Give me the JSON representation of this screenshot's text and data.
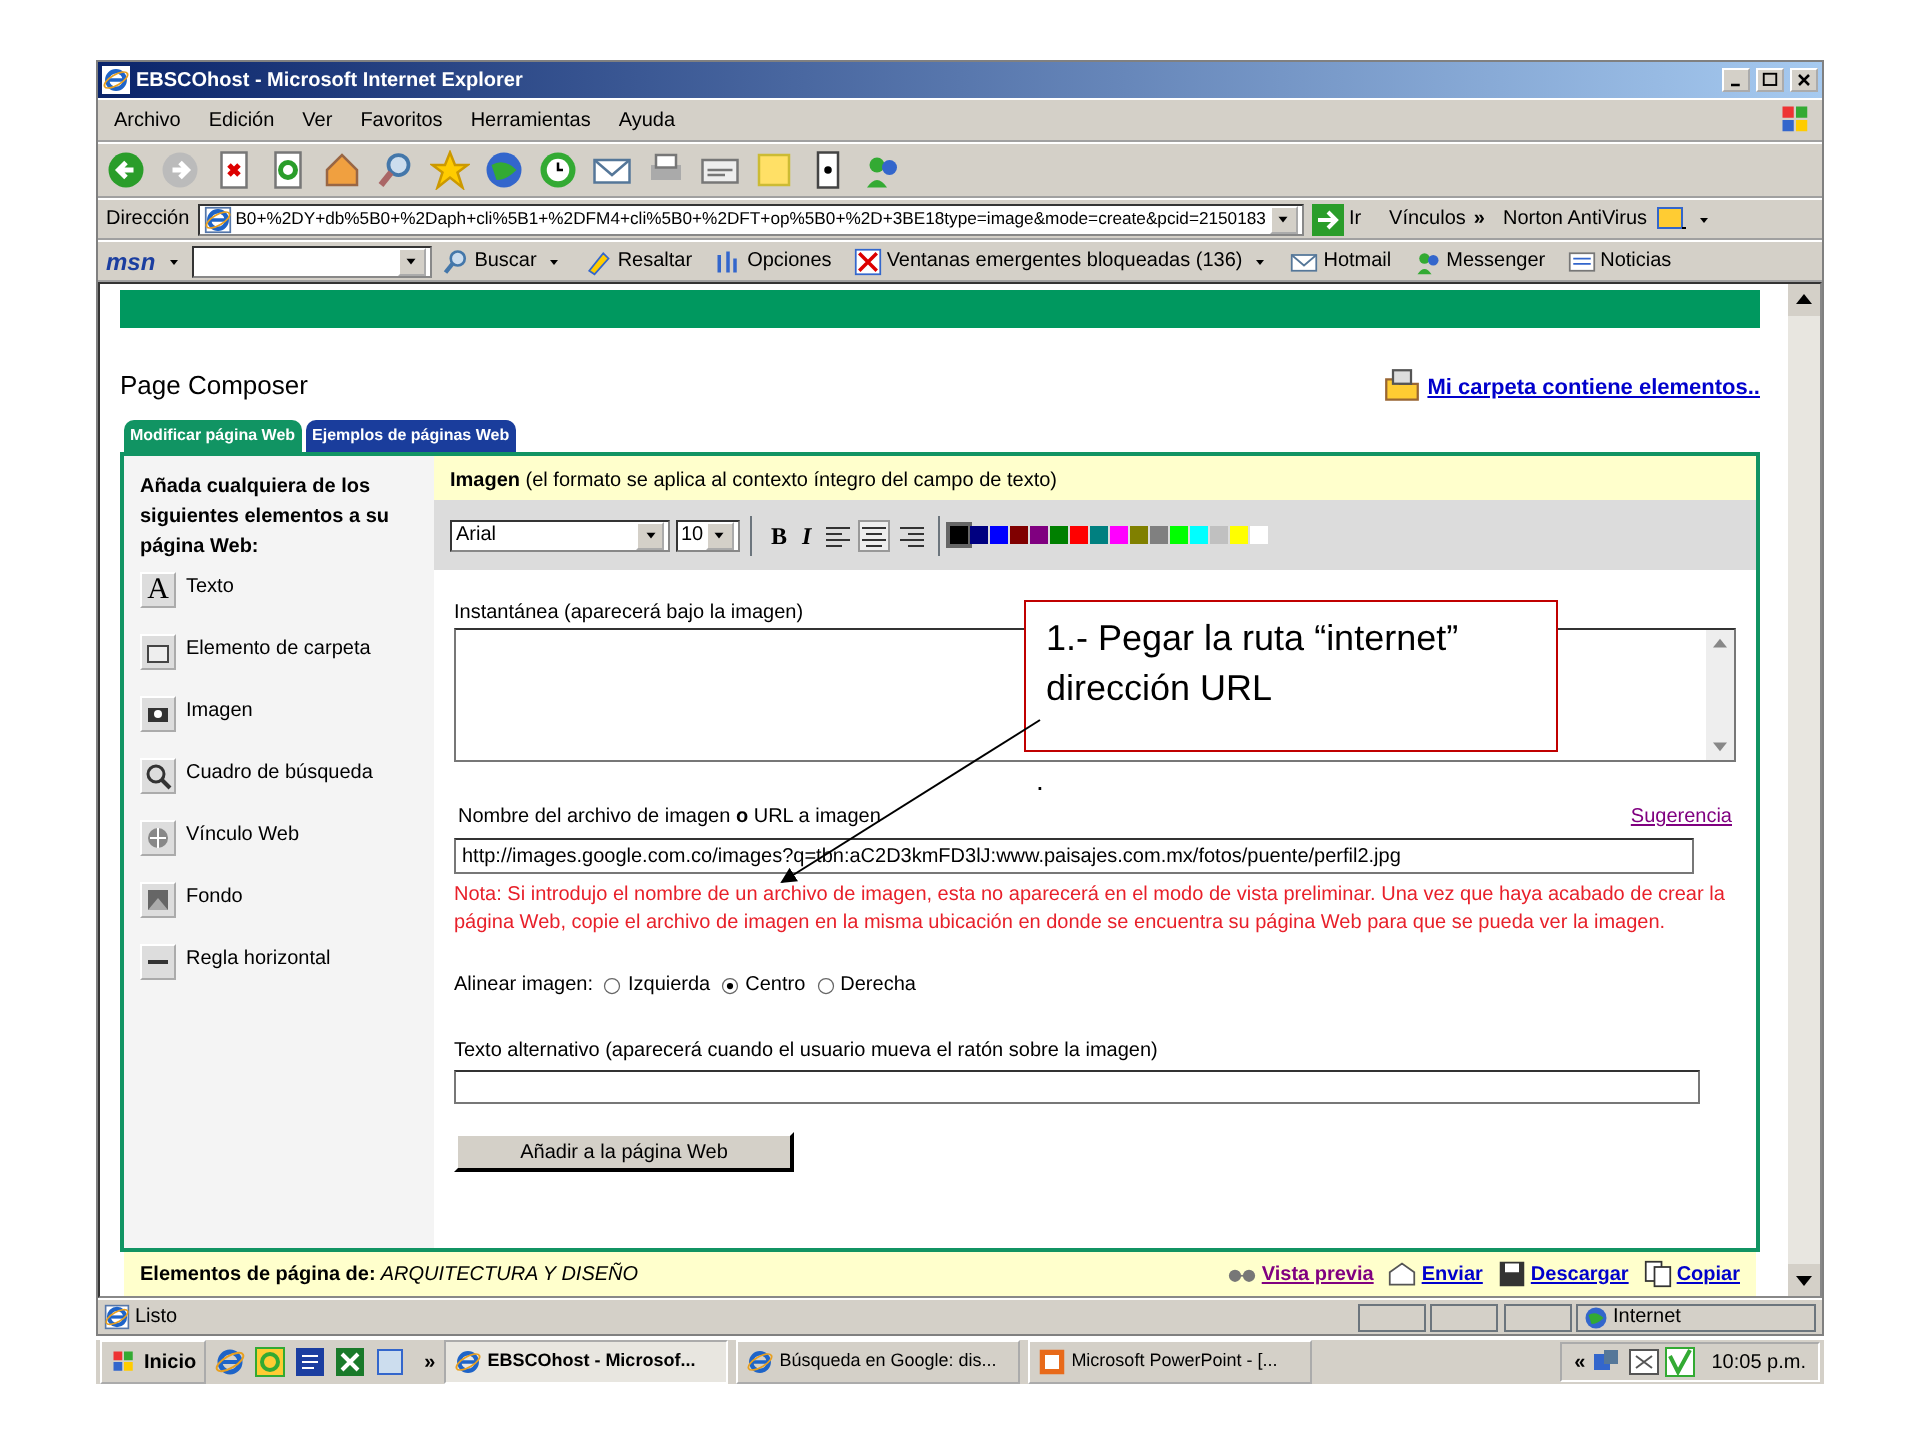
{
  "window": {
    "title": "EBSCOhost - Microsoft Internet Explorer"
  },
  "menu_bar": [
    "Archivo",
    "Edición",
    "Ver",
    "Favoritos",
    "Herramientas",
    "Ayuda"
  ],
  "address_bar": {
    "label": "Dirección",
    "value": "B0+%2DY+db%5B0+%2Daph+cli%5B1+%2DFM4+cli%5B0+%2DFT+op%5B0+%2D+3BE18type=image&mode=create&pcid=2150183",
    "go": "Ir",
    "links": "Vínculos",
    "chevron": "»",
    "extra": "Norton AntiVirus"
  },
  "msn_bar": {
    "logo": "msn",
    "items": [
      "Buscar",
      "Resaltar",
      "Opciones",
      "Ventanas emergentes bloqueadas (136)",
      "Hotmail",
      "Messenger",
      "Noticias"
    ]
  },
  "page": {
    "title": "Page Composer",
    "folder_link": "Mi carpeta contiene elementos..",
    "tabs": [
      {
        "label": "Modificar página Web",
        "selected": true
      },
      {
        "label": "Ejemplos de páginas Web",
        "selected": false
      }
    ],
    "sidebar": {
      "text_icon_letter": "A",
      "heading": "Añada cualquiera de los siguientes elementos a su página Web:",
      "items": [
        "Texto",
        "Elemento de carpeta",
        "Imagen",
        "Cuadro de búsqueda",
        "Vínculo Web",
        "Fondo",
        "Regla horizontal"
      ]
    },
    "editor": {
      "header": "**Imagen** (el formato se aplica al contexto íntegro del campo de texto)",
      "font": "Arial",
      "size": "10",
      "bold_label": "B",
      "italic_label": "I",
      "colors": [
        {
          "color": "#000000",
          "selected": true
        },
        {
          "color": "#000080",
          "selected": false
        },
        {
          "color": "#0000ff",
          "selected": false
        },
        {
          "color": "#800000",
          "selected": false
        },
        {
          "color": "#800080",
          "selected": false
        },
        {
          "color": "#008000",
          "selected": false
        },
        {
          "color": "#ff0000",
          "selected": false
        },
        {
          "color": "#008080",
          "selected": false
        },
        {
          "color": "#ff00ff",
          "selected": false
        },
        {
          "color": "#808000",
          "selected": false
        },
        {
          "color": "#808080",
          "selected": false
        },
        {
          "color": "#00ff00",
          "selected": false
        },
        {
          "color": "#00ffff",
          "selected": false
        },
        {
          "color": "#c0c0c0",
          "selected": false
        },
        {
          "color": "#ffff00",
          "selected": false
        },
        {
          "color": "#ffffff",
          "selected": false
        }
      ],
      "caption_label": "Instantánea (aparecerá bajo la imagen)",
      "url_label": "Nombre del archivo de imagen **o** URL a imagen",
      "hint_link": "Sugerencia",
      "url_value": "http://images.google.com.co/images?q=tbn:aC2D3kmFD3lJ:www.paisajes.com.mx/fotos/puente/perfil2.jpg",
      "note": "Nota: Si introdujo el nombre de un archivo de imagen, esta no aparecerá en el modo de vista preliminar. Una vez que haya acabado de crear la página Web, copie el archivo de imagen en la misma ubicación en donde se encuentra su página Web para que se pueda ver la imagen.",
      "align_label": "Alinear imagen:",
      "align_options": [
        {
          "label": "Izquierda",
          "selected": false
        },
        {
          "label": "Centro",
          "selected": true
        },
        {
          "label": "Derecha",
          "selected": false
        }
      ],
      "alt_label": "Texto alternativo (aparecerá cuando el usuario mueva el ratón sobre la imagen)",
      "add_button": "Añadir a la página Web"
    },
    "footer": {
      "label": "Elementos de página de:",
      "folder": "ARQUITECTURA Y DISEÑO",
      "links": [
        "Vista previa",
        "Enviar",
        "Descargar",
        "Copiar"
      ]
    }
  },
  "callout": {
    "lines": [
      "1.- Pegar la ruta “internet”",
      "dirección URL"
    ],
    "dot": "."
  },
  "status_bar": {
    "text": "Listo",
    "zone": "Internet"
  },
  "taskbar": {
    "start": "Inicio",
    "chevron": "»",
    "tasks": [
      {
        "label": "EBSCOhost - Microsof...",
        "selected": true
      },
      {
        "label": "Búsqueda en Google: dis...",
        "selected": false
      },
      {
        "label": "Microsoft PowerPoint - [...",
        "selected": false
      }
    ],
    "tray_chevron": "«",
    "time": "10:05 p.m."
  }
}
